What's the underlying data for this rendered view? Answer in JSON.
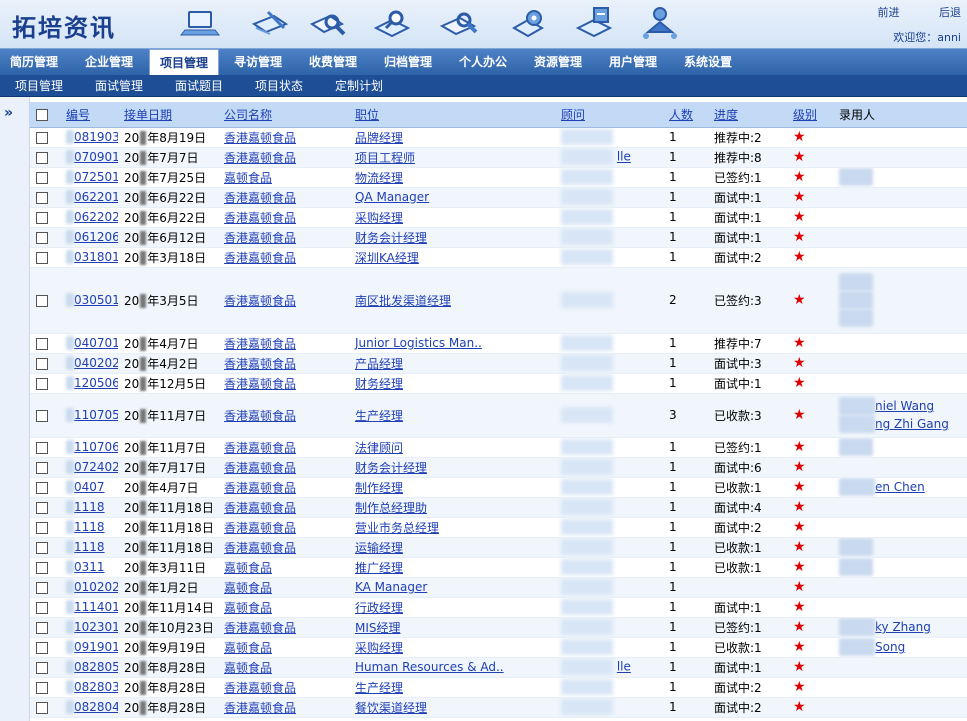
{
  "header": {
    "logo": "拓培资讯",
    "forward": "前进",
    "back": "后退",
    "welcome": "欢迎您：anni",
    "icons": [
      "laptop-icon",
      "pencil-pad-icon",
      "search-magnifier-icon",
      "folder-search-icon",
      "document-search-icon",
      "settings-gear-icon",
      "calendar-calculator-icon",
      "user-network-icon"
    ]
  },
  "main_nav": [
    "简历管理",
    "企业管理",
    "项目管理",
    "寻访管理",
    "收费管理",
    "归档管理",
    "个人办公",
    "资源管理",
    "用户管理",
    "系统设置"
  ],
  "main_nav_active": "项目管理",
  "sub_nav": [
    "项目管理",
    "面试管理",
    "面试题目",
    "项目状态",
    "定制计划"
  ],
  "table": {
    "headers": [
      "编号",
      "接单日期",
      "公司名称",
      "职位",
      "顾问",
      "人数",
      "进度",
      "级别",
      "录用人"
    ],
    "rows": [
      {
        "id": "081903",
        "date": "年8月19日",
        "company": "香港嘉顿食品",
        "position": "品牌经理",
        "consultant": "",
        "count": "1",
        "progress": "推荐中:2",
        "recruits": []
      },
      {
        "id": "070901",
        "date": "年7月7日",
        "company": "香港嘉顿食品",
        "position": "项目工程师",
        "consultant": "lle",
        "count": "1",
        "progress": "推荐中:8",
        "recruits": []
      },
      {
        "id": "072501",
        "date": "年7月25日",
        "company": "嘉顿食品",
        "position": "物流经理",
        "consultant": "",
        "count": "1",
        "progress": "已签约:1",
        "recruits": [
          ""
        ]
      },
      {
        "id": "062201",
        "date": "年6月22日",
        "company": "香港嘉顿食品",
        "position": "QA Manager",
        "consultant": "",
        "count": "1",
        "progress": "面试中:1",
        "recruits": []
      },
      {
        "id": "062202",
        "date": "年6月22日",
        "company": "香港嘉顿食品",
        "position": "采购经理",
        "consultant": "",
        "count": "1",
        "progress": "面试中:1",
        "recruits": []
      },
      {
        "id": "061206",
        "date": "年6月12日",
        "company": "香港嘉顿食品",
        "position": "财务会计经理",
        "consultant": "",
        "count": "1",
        "progress": "面试中:1",
        "recruits": []
      },
      {
        "id": "031801",
        "date": "年3月18日",
        "company": "香港嘉顿食品",
        "position": "深圳KA经理",
        "consultant": "",
        "count": "1",
        "progress": "面试中:2",
        "recruits": []
      },
      {
        "id": "030501",
        "date": "年3月5日",
        "company": "香港嘉顿食品",
        "position": "南区批发渠道经理",
        "consultant": "",
        "count": "2",
        "progress": "已签约:3",
        "recruits": [
          "",
          "",
          ""
        ],
        "tall": true
      },
      {
        "id": "040701",
        "date": "年4月7日",
        "company": "香港嘉顿食品",
        "position": "Junior Logistics Man..",
        "consultant": "",
        "count": "1",
        "progress": "推荐中:7",
        "recruits": []
      },
      {
        "id": "040202",
        "date": "年4月2日",
        "company": "香港嘉顿食品",
        "position": "产品经理",
        "consultant": "",
        "count": "1",
        "progress": "面试中:3",
        "recruits": []
      },
      {
        "id": "120506",
        "date": "年12月5日",
        "company": "香港嘉顿食品",
        "position": "财务经理",
        "consultant": "",
        "count": "1",
        "progress": "面试中:1",
        "recruits": []
      },
      {
        "id": "110705",
        "date": "年11月7日",
        "company": "香港嘉顿食品",
        "position": "生产经理",
        "consultant": "",
        "count": "3",
        "progress": "已收款:3",
        "recruits": [
          "niel Wang",
          "ng Zhi Gang"
        ],
        "medium": true
      },
      {
        "id": "110706",
        "date": "年11月7日",
        "company": "香港嘉顿食品",
        "position": "法律顾问",
        "consultant": "",
        "count": "1",
        "progress": "已签约:1",
        "recruits": [
          ""
        ]
      },
      {
        "id": "072402",
        "date": "年7月17日",
        "company": "香港嘉顿食品",
        "position": "财务会计经理",
        "consultant": "",
        "count": "1",
        "progress": "面试中:6",
        "recruits": []
      },
      {
        "id": "0407",
        "date": "年4月7日",
        "company": "香港嘉顿食品",
        "position": "制作经理",
        "consultant": "",
        "count": "1",
        "progress": "已收款:1",
        "recruits": [
          "en Chen"
        ]
      },
      {
        "id": "1118",
        "date": "年11月18日",
        "company": "香港嘉顿食品",
        "position": "制作总经理助",
        "consultant": "",
        "count": "1",
        "progress": "面试中:4",
        "recruits": []
      },
      {
        "id": "1118",
        "date": "年11月18日",
        "company": "香港嘉顿食品",
        "position": "营业市务总经理",
        "consultant": "",
        "count": "1",
        "progress": "面试中:2",
        "recruits": []
      },
      {
        "id": "1118",
        "date": "年11月18日",
        "company": "香港嘉顿食品",
        "position": "运输经理",
        "consultant": "",
        "count": "1",
        "progress": "已收款:1",
        "recruits": [
          ""
        ]
      },
      {
        "id": "0311",
        "date": "年3月11日",
        "company": "嘉顿食品",
        "position": "推广经理",
        "consultant": "",
        "count": "1",
        "progress": "已收款:1",
        "recruits": [
          ""
        ]
      },
      {
        "id": "010202",
        "date": "年1月2日",
        "company": "嘉顿食品",
        "position": "KA Manager",
        "consultant": "",
        "count": "1",
        "progress": "",
        "recruits": []
      },
      {
        "id": "111401",
        "date": "年11月14日",
        "company": "嘉顿食品",
        "position": "行政经理",
        "consultant": "",
        "count": "1",
        "progress": "面试中:1",
        "recruits": []
      },
      {
        "id": "102301",
        "date": "年10月23日",
        "company": "香港嘉顿食品",
        "position": "MIS经理",
        "consultant": "",
        "count": "1",
        "progress": "已签约:1",
        "recruits": [
          "ky Zhang"
        ]
      },
      {
        "id": "091901",
        "date": "年9月19日",
        "company": "嘉顿食品",
        "position": "采购经理",
        "consultant": "",
        "count": "1",
        "progress": "已收款:1",
        "recruits": [
          "Song"
        ]
      },
      {
        "id": "082805",
        "date": "年8月28日",
        "company": "嘉顿食品",
        "position": "Human Resources & Ad..",
        "consultant": "lle",
        "count": "1",
        "progress": "面试中:1",
        "recruits": []
      },
      {
        "id": "082803",
        "date": "年8月28日",
        "company": "香港嘉顿食品",
        "position": "生产经理",
        "consultant": "",
        "count": "1",
        "progress": "面试中:2",
        "recruits": []
      },
      {
        "id": "082804",
        "date": "年8月28日",
        "company": "香港嘉顿食品",
        "position": "餐饮渠道经理",
        "consultant": "",
        "count": "1",
        "progress": "面试中:2",
        "recruits": []
      }
    ]
  },
  "colors": {
    "nav_blue": "#2f63a8",
    "subnav_blue": "#1e4f96",
    "header_row": "#c2daf5",
    "link": "#1f3fb5",
    "star": "#e00000"
  }
}
